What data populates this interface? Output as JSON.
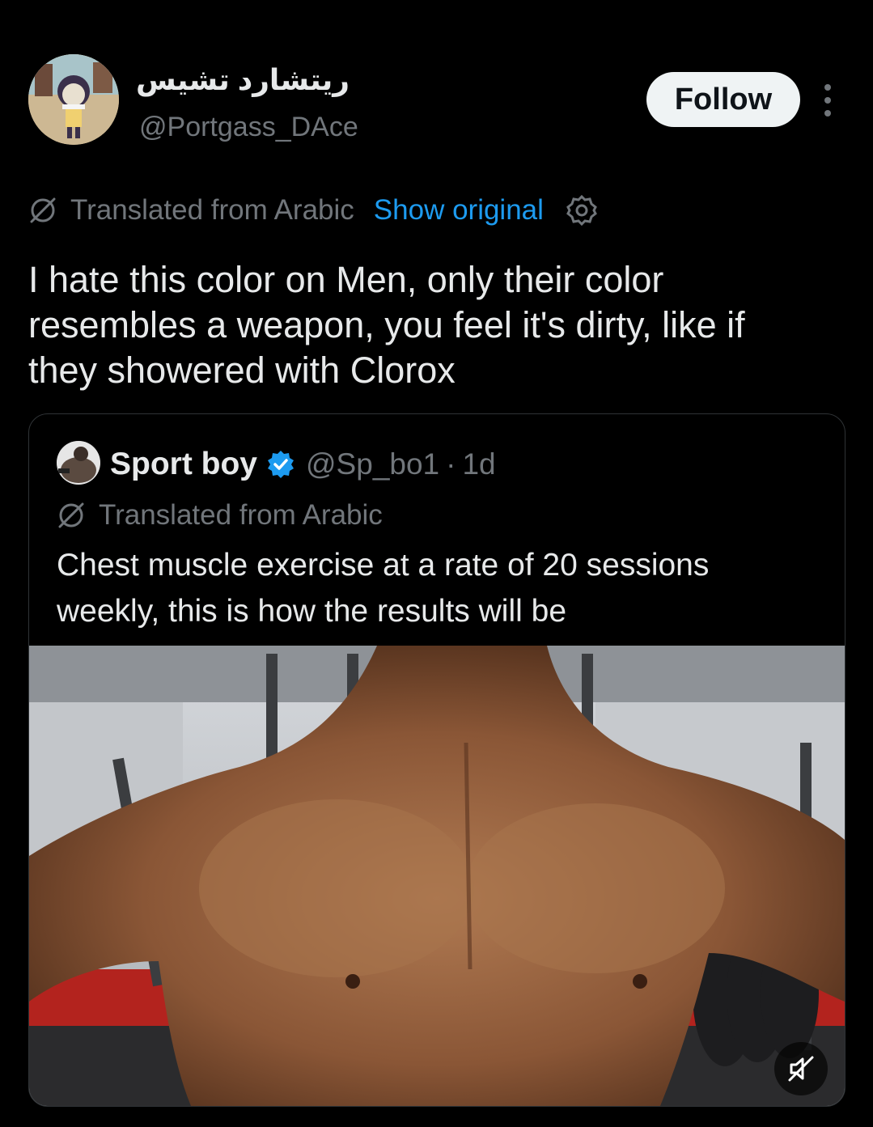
{
  "author": {
    "display_name": "ريتشارد تشيس",
    "handle": "@Portgass_DAce",
    "avatar_icon": "avatar-cartoon-character"
  },
  "follow_label": "Follow",
  "translation": {
    "label": "Translated from Arabic",
    "show_original": "Show original"
  },
  "tweet": {
    "lines": [
      "I hate this color on Men, only their color",
      "resembles a weapon, you feel it's dirty, like if",
      "they showered with Clorox"
    ]
  },
  "quote": {
    "name": "Sport boy",
    "handle": "@Sp_bo1",
    "separator": "·",
    "time": "1d",
    "translated_label": "Translated from Arabic",
    "lines": [
      "Chest muscle exercise at a rate of 20 sessions",
      "weekly, this is how the results will be"
    ],
    "media_description_icon": "video-thumbnail",
    "mute_icon": "muted-speaker-icon"
  },
  "colors": {
    "background": "#000000",
    "text": "#e7e9ea",
    "secondary": "#71767b",
    "link": "#1d9bf0",
    "verified": "#1d9bf0",
    "follow_bg": "#eff3f4"
  }
}
